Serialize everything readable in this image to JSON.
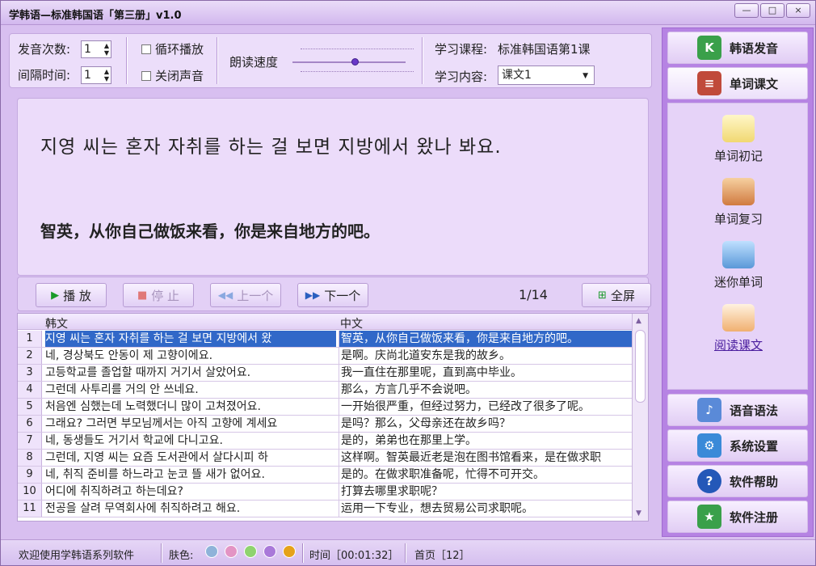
{
  "window": {
    "title": "学韩语—标准韩国语「第三册」v1.0",
    "min": "—",
    "max": "□",
    "close": "×"
  },
  "settings": {
    "repeat_label": "发音次数:",
    "repeat_value": "1",
    "interval_label": "间隔时间:",
    "interval_value": "1",
    "loop_label": "循环播放",
    "mute_label": "关闭声音",
    "speed_label": "朗读速度",
    "speed_value": 0.48,
    "course_label": "学习课程:",
    "course_value": "标准韩国语第1课",
    "content_label": "学习内容:",
    "content_value": "课文1"
  },
  "display": {
    "korean": "지영 씨는 혼자 자취를 하는 걸 보면 지방에서 왔나 봐요.",
    "chinese": "智英，从你自己做饭来看，你是来自地方的吧。"
  },
  "controls": {
    "play": "播 放",
    "stop": "停 止",
    "prev": "上一个",
    "next": "下一个",
    "counter": "1/14",
    "fullscreen": "全屏"
  },
  "table": {
    "col_korean": "韩文",
    "col_chinese": "中文",
    "rows": [
      {
        "n": "1",
        "k": "지영 씨는 혼자 자취를 하는 걸 보면 지방에서 왔",
        "c": "智英，从你自己做饭来看，你是来自地方的吧。"
      },
      {
        "n": "2",
        "k": "네, 경상북도 안동이 제 고향이에요.",
        "c": "是啊。庆尚北道安东是我的故乡。"
      },
      {
        "n": "3",
        "k": "고등학교를 졸업할 때까지 거기서 살았어요.",
        "c": "我一直住在那里呢，直到高中毕业。"
      },
      {
        "n": "4",
        "k": "그런데 사투리를 거의 안 쓰네요.",
        "c": "那么，方言几乎不会说吧。"
      },
      {
        "n": "5",
        "k": "처음엔 심했는데 노력했더니 많이 고쳐졌어요.",
        "c": "一开始很严重，但经过努力，已经改了很多了呢。"
      },
      {
        "n": "6",
        "k": "그래요? 그러면 부모님께서는 아직 고향에 계세요",
        "c": "是吗？那么，父母亲还在故乡吗？"
      },
      {
        "n": "7",
        "k": "네, 동생들도 거기서 학교에 다니고요.",
        "c": "是的，弟弟也在那里上学。"
      },
      {
        "n": "8",
        "k": "그런데, 지영 씨는 요즘 도서관에서 살다시피 하",
        "c": "这样啊。智英最近老是泡在图书馆看来，是在做求职"
      },
      {
        "n": "9",
        "k": "네, 취직 준비를 하느라고 눈코 뜰 새가 없어요.",
        "c": "是的。在做求职准备呢，忙得不可开交。"
      },
      {
        "n": "10",
        "k": "어디에 취직하려고 하는데요?",
        "c": "打算去哪里求职呢？"
      },
      {
        "n": "11",
        "k": "전공을 살려 무역회사에 취직하려고 해요.",
        "c": "运用一下专业，想去贸易公司求职呢。"
      }
    ]
  },
  "sidebar": {
    "pronunciation": "韩语发音",
    "vocab_text": "单词课文",
    "sub": [
      "单词初记",
      "单词复习",
      "迷你单词",
      "阅读课文"
    ],
    "grammar": "语音语法",
    "settings": "系统设置",
    "help": "软件帮助",
    "register": "软件注册"
  },
  "statusbar": {
    "welcome": "欢迎使用学韩语系列软件",
    "skin_label": "肤色:",
    "skins": [
      "#8fb3d9",
      "#e394c4",
      "#8fd36f",
      "#a979d9",
      "#e5a21a"
    ],
    "time": "时间［00:01:32］",
    "page": "首页［12］"
  },
  "colors": {
    "accent": "#3168c8",
    "sidebar": "#b683e3"
  }
}
